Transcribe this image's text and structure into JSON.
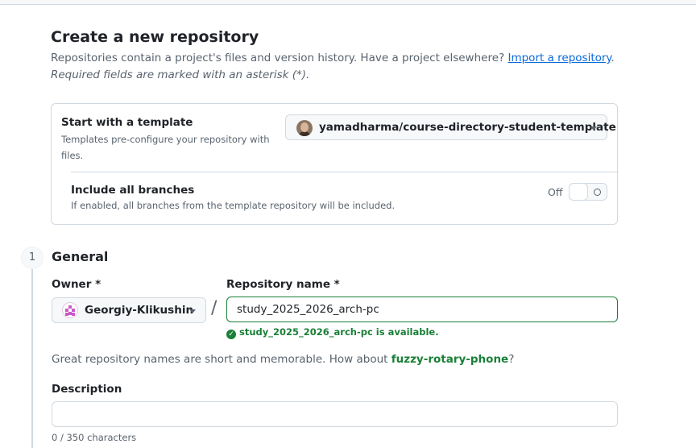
{
  "page": {
    "title": "Create a new repository",
    "intro_text": "Repositories contain a project's files and version history. Have a project elsewhere?",
    "import_link": "Import a repository",
    "intro_end": ".",
    "required_note": "Required fields are marked with an asterisk (*)."
  },
  "template": {
    "heading": "Start with a template",
    "description": "Templates pre-configure your repository with files.",
    "selected": "yamadharma/course-directory-student-template",
    "include_branches_heading": "Include all branches",
    "include_branches_desc": "If enabled, all branches from the template repository will be included.",
    "toggle_state": "Off"
  },
  "general": {
    "step": "1",
    "title": "General",
    "owner_label": "Owner *",
    "owner": "Georgiy-Klikushin",
    "slash": "/",
    "repo_label": "Repository name *",
    "repo_value": "study_2025_2026_arch-pc",
    "availability": "study_2025_2026_arch-pc is available.",
    "suggestion_prefix": "Great repository names are short and memorable. How about ",
    "suggestion_name": "fuzzy-rotary-phone",
    "suggestion_suffix": "?",
    "description_label": "Description",
    "description_value": "",
    "char_count": "0 / 350 characters"
  },
  "colors": {
    "accent_link": "#0969da",
    "success": "#1a7f37",
    "border": "#d1d9e0",
    "muted_text": "#59636e"
  }
}
